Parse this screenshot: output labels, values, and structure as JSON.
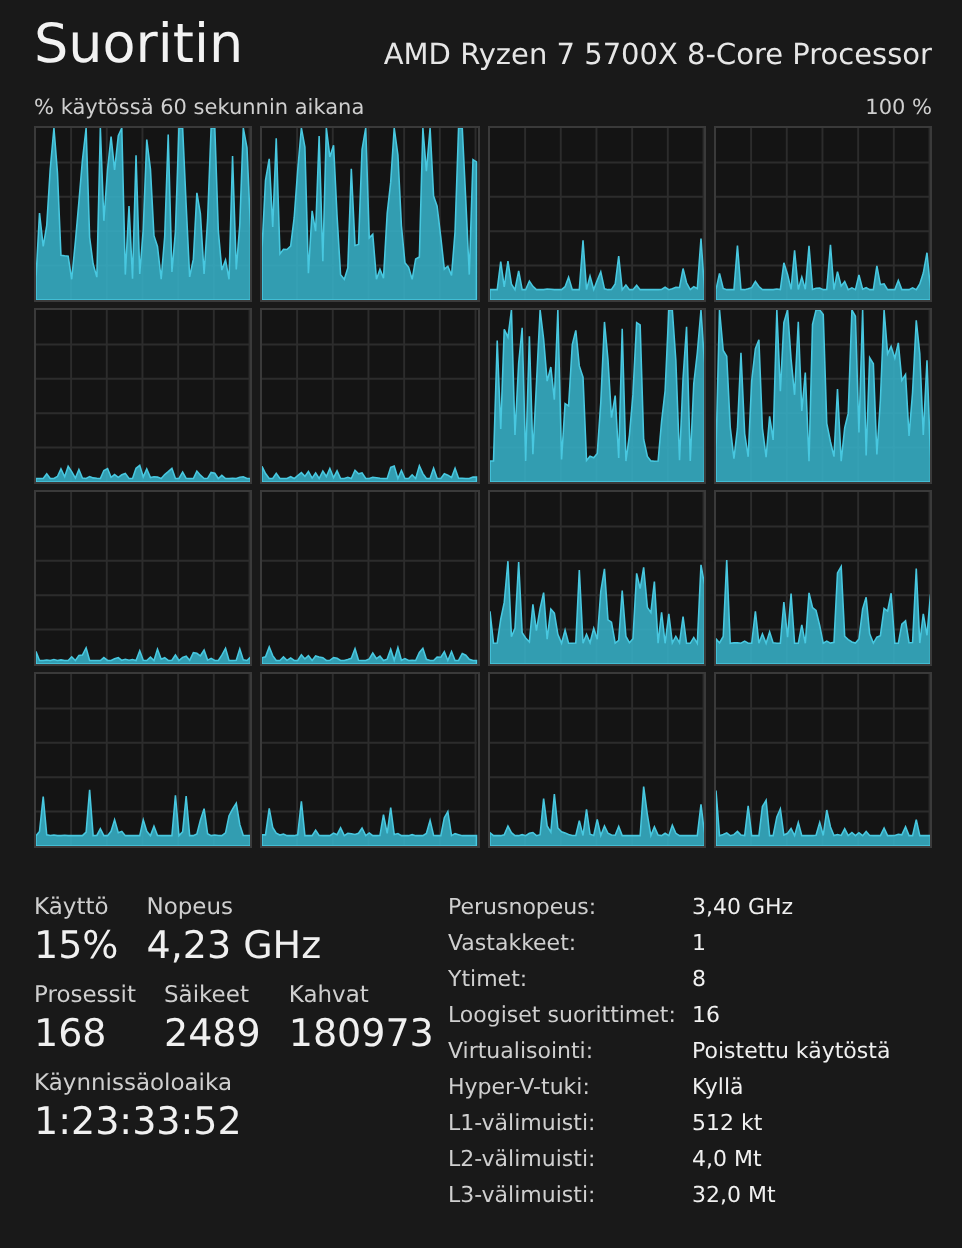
{
  "header": {
    "title": "Suoritin",
    "processor": "AMD Ryzen 7 5700X 8-Core Processor"
  },
  "graph_area": {
    "caption": "% käytössä 60 sekunnin aikana",
    "max_label": "100 %"
  },
  "graphs": [
    {
      "kind": "busy"
    },
    {
      "kind": "busy"
    },
    {
      "kind": "low"
    },
    {
      "kind": "low"
    },
    {
      "kind": "idle"
    },
    {
      "kind": "idle"
    },
    {
      "kind": "busy"
    },
    {
      "kind": "busy"
    },
    {
      "kind": "idle"
    },
    {
      "kind": "idle"
    },
    {
      "kind": "moderate"
    },
    {
      "kind": "moderate"
    },
    {
      "kind": "low"
    },
    {
      "kind": "low"
    },
    {
      "kind": "low"
    },
    {
      "kind": "low"
    }
  ],
  "stats": [
    [
      {
        "label": "Käyttö",
        "value": "15%"
      },
      {
        "label": "Nopeus",
        "value": "4,23 GHz"
      }
    ],
    [
      {
        "label": "Prosessit",
        "value": "168"
      },
      {
        "label": "Säikeet",
        "value": "2489"
      },
      {
        "label": "Kahvat",
        "value": "180973"
      }
    ],
    [
      {
        "label": "Käynnissäoloaika",
        "value": "1:23:33:52"
      }
    ]
  ],
  "details": [
    {
      "label": "Perusnopeus:",
      "value": "3,40 GHz"
    },
    {
      "label": "Vastakkeet:",
      "value": "1"
    },
    {
      "label": "Ytimet:",
      "value": "8"
    },
    {
      "label": "Loogiset suorittimet:",
      "value": "16"
    },
    {
      "label": "Virtualisointi:",
      "value": "Poistettu käytöstä"
    },
    {
      "label": "Hyper-V-tuki:",
      "value": "Kyllä"
    },
    {
      "label": "L1-välimuisti:",
      "value": "512 kt"
    },
    {
      "label": "L2-välimuisti:",
      "value": "4,0 Mt"
    },
    {
      "label": "L3-välimuisti:",
      "value": "32,0 Mt"
    }
  ]
}
